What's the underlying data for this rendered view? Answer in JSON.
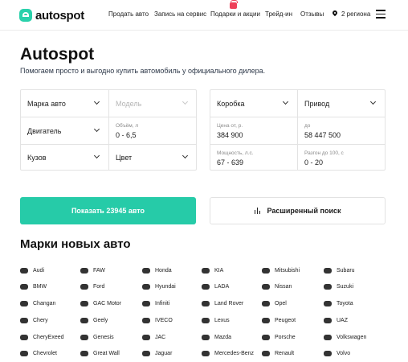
{
  "header": {
    "logo_text": "autospot",
    "nav": [
      "Продать авто",
      "Запись на сервис",
      "Подарки и акции",
      "Трейд-ин",
      "Отзывы"
    ],
    "region": "2 региона"
  },
  "hero": {
    "title": "Autospot",
    "subtitle": "Помогаем просто и выгодно купить автомобиль у официального дилера."
  },
  "filters": {
    "brand": "Марка авто",
    "model": "Модель",
    "engine": "Двигатель",
    "volume_label": "Объём, л",
    "volume_value": "0 - 6,5",
    "body": "Кузов",
    "color": "Цвет",
    "gearbox": "Коробка",
    "drive": "Привод",
    "price_from_label": "Цена от, р.",
    "price_from_value": "384 900",
    "price_to_label": "до",
    "price_to_value": "58 447 500",
    "power_label": "Мощность, л.с.",
    "power_value": "67 - 639",
    "accel_label": "Разгон до 100, с",
    "accel_value": "0 - 20"
  },
  "actions": {
    "show_label": "Показать 23945 авто",
    "advanced_label": "Расширенный поиск"
  },
  "brands": {
    "title": "Марки новых авто",
    "columns": [
      [
        "Audi",
        "BMW",
        "Changan",
        "Chery",
        "CheryExeed",
        "Chevrolet"
      ],
      [
        "FAW",
        "Ford",
        "GAC Motor",
        "Geely",
        "Genesis",
        "Great Wall"
      ],
      [
        "Honda",
        "Hyundai",
        "Infiniti",
        "IVECO",
        "JAC",
        "Jaguar"
      ],
      [
        "KIA",
        "LADA",
        "Land Rover",
        "Lexus",
        "Mazda",
        "Mercedes-Benz"
      ],
      [
        "Mitsubishi",
        "Nissan",
        "Opel",
        "Peugeot",
        "Porsche",
        "Renault"
      ],
      [
        "Subaru",
        "Suzuki",
        "Toyota",
        "UAZ",
        "Volkswagen",
        "Volvo"
      ]
    ]
  }
}
